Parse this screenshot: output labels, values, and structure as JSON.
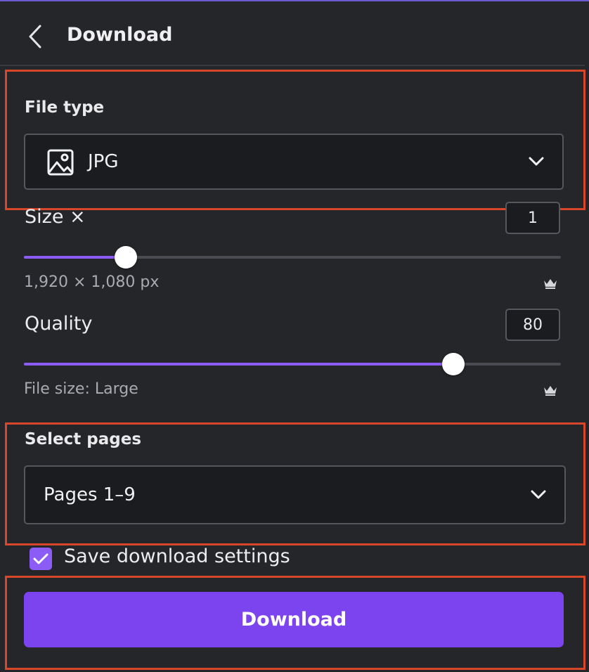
{
  "header": {
    "title": "Download"
  },
  "file_type": {
    "label": "File type",
    "selected": "JPG",
    "icon": "image-icon"
  },
  "size": {
    "label": "Size ×",
    "value": "1",
    "slider_fraction": 0.19,
    "dimensions": "1,920 × 1,080 px"
  },
  "quality": {
    "label": "Quality",
    "value": "80",
    "slider_fraction": 0.8,
    "file_size": "File size: Large"
  },
  "pages": {
    "label": "Select pages",
    "selected": "Pages 1–9"
  },
  "save_settings": {
    "label": "Save download settings",
    "checked": true
  },
  "download_button": {
    "label": "Download"
  },
  "colors": {
    "accent": "#7c44ee",
    "slider_fill": "#8b5cf6",
    "highlight_box": "#d9472b",
    "background": "#252629"
  }
}
